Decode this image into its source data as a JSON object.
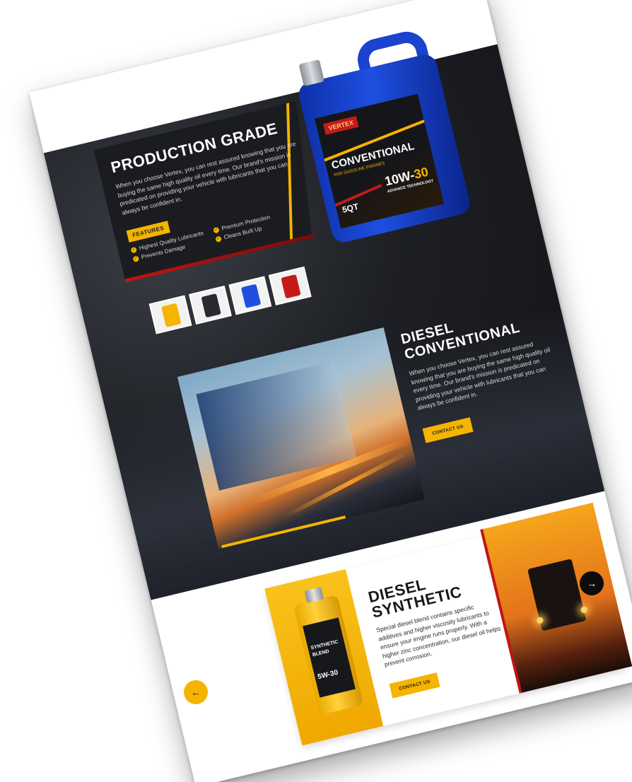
{
  "colors": {
    "accent": "#f4b400",
    "dark": "#1b1c20",
    "red": "#c01515",
    "jug_blue": "#1e4fe0"
  },
  "production": {
    "title": "PRODUCTION GRADE",
    "text": "When you choose Vertex, you can rest assured knowing that you are buying the same high quality oil every time. Our brand's mission is predicated on providing your vehicle with lubricants that you can always be confident in.",
    "features_badge": "FEATURES",
    "features": [
      "Highest Quality Lubricants",
      "Prevents Damage",
      "Premium Protection",
      "Cleans Built Up"
    ]
  },
  "jug_label": {
    "brand": "VERTEX",
    "name": "CONVENTIONAL",
    "sub": "FOR GASOLINE ENGINES",
    "viscosity_a": "10W-",
    "viscosity_b": "30",
    "tech": "ADVANCE TECHNOLOGY",
    "size": "5QT"
  },
  "thumbnails": [
    {
      "icon": "yellow-bottle-icon",
      "color": "#f4b400"
    },
    {
      "icon": "black-bottle-icon",
      "color": "#2a2b30"
    },
    {
      "icon": "blue-jug-icon",
      "color": "#1e4fe0"
    },
    {
      "icon": "red-bottle-icon",
      "color": "#c41a1a"
    }
  ],
  "diesel_conventional": {
    "title_line1": "DIESEL",
    "title_line2": "CONVENTIONAL",
    "text": "When you choose Vertex, you can rest assured knowing that you are buying the same high quality oil every time. Our brand's mission is predicated on providing your vehicle with lubricants that you can always be confident in.",
    "button": "CONTACT US"
  },
  "diesel_synthetic": {
    "title_line1": "DIESEL",
    "title_line2": "SYNTHETIC",
    "text": "Special diesel blend contains specific additives and higher viscosity lubricants to ensure your engine runs properly. With a higher zinc concentration, our diesel oil helps prevent corrosion.",
    "button": "CONTACT US",
    "bottle_label_1": "SYNTHETIC",
    "bottle_label_2": "BLEND",
    "bottle_label_3": "5W-30"
  },
  "nav": {
    "next_icon": "→",
    "prev_icon": "←"
  }
}
